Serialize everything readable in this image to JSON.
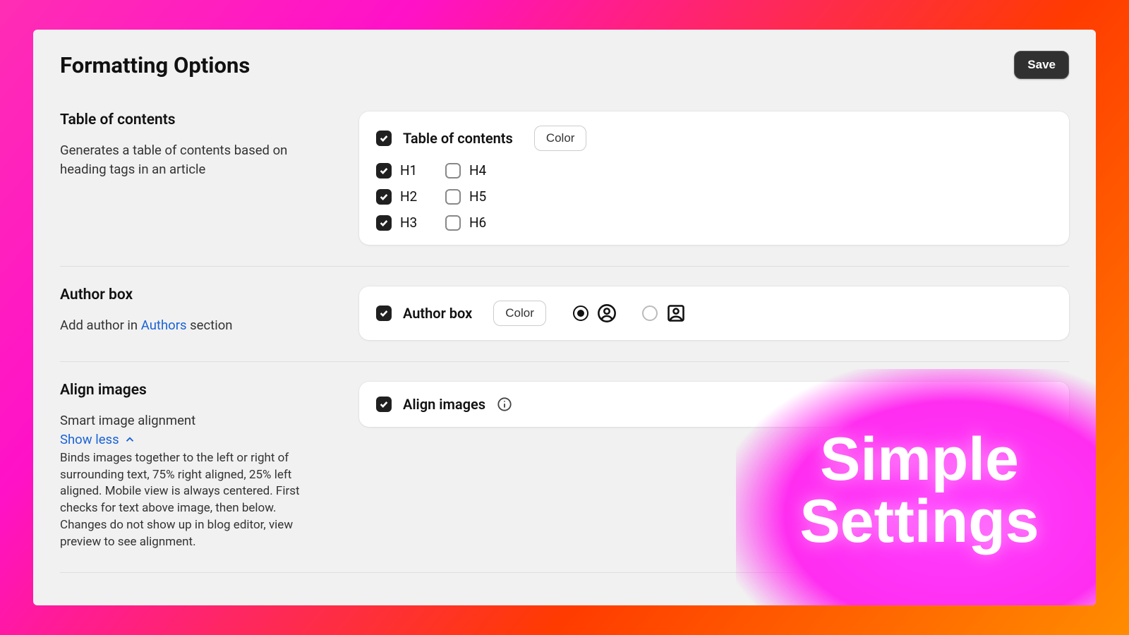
{
  "header": {
    "title": "Formatting Options",
    "save": "Save"
  },
  "toc": {
    "title": "Table of contents",
    "desc": "Generates a table of contents based on heading tags in an article",
    "checkbox_label": "Table of contents",
    "color_btn": "Color",
    "headings": [
      {
        "label": "H1",
        "checked": true
      },
      {
        "label": "H2",
        "checked": true
      },
      {
        "label": "H3",
        "checked": true
      },
      {
        "label": "H4",
        "checked": false
      },
      {
        "label": "H5",
        "checked": false
      },
      {
        "label": "H6",
        "checked": false
      }
    ]
  },
  "author": {
    "title": "Author box",
    "desc_pre": "Add author in ",
    "desc_link": "Authors",
    "desc_post": " section",
    "checkbox_label": "Author box",
    "color_btn": "Color"
  },
  "align": {
    "title": "Align images",
    "sub": "Smart image alignment",
    "showless": "Show less",
    "detail": "Binds images together to the left or right of surrounding text, 75% right aligned, 25% left aligned. Mobile view is always centered. First checks for text above image, then below. Changes do not show up in blog editor, view preview to see alignment.",
    "checkbox_label": "Align images"
  },
  "overlay": {
    "line1": "Simple",
    "line2": "Settings"
  }
}
